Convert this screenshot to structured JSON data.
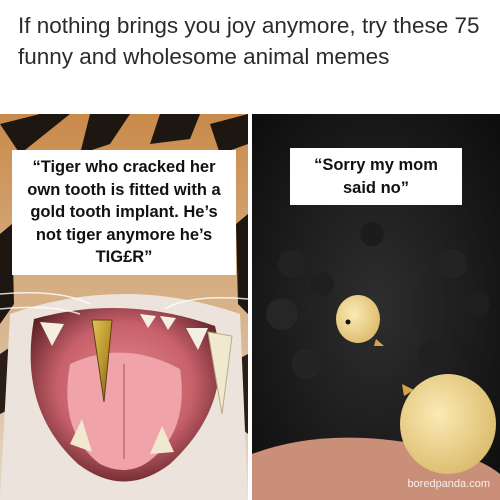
{
  "header": {
    "headline": "If nothing brings you joy anymore, try these 75 funny and wholesome animal memes"
  },
  "left_panel": {
    "caption": "“Tiger who cracked her own tooth is fitted with a gold tooth implant. He’s not tiger anymore he’s TIG£R”"
  },
  "right_panel": {
    "caption": "“Sorry my mom said no”",
    "watermark": "boredpanda.com"
  },
  "colors": {
    "header_text": "#2b2b2b",
    "caption_background": "#ffffff",
    "gold_tooth": "#b8942a",
    "chick_yellow": "#f3d98f"
  }
}
